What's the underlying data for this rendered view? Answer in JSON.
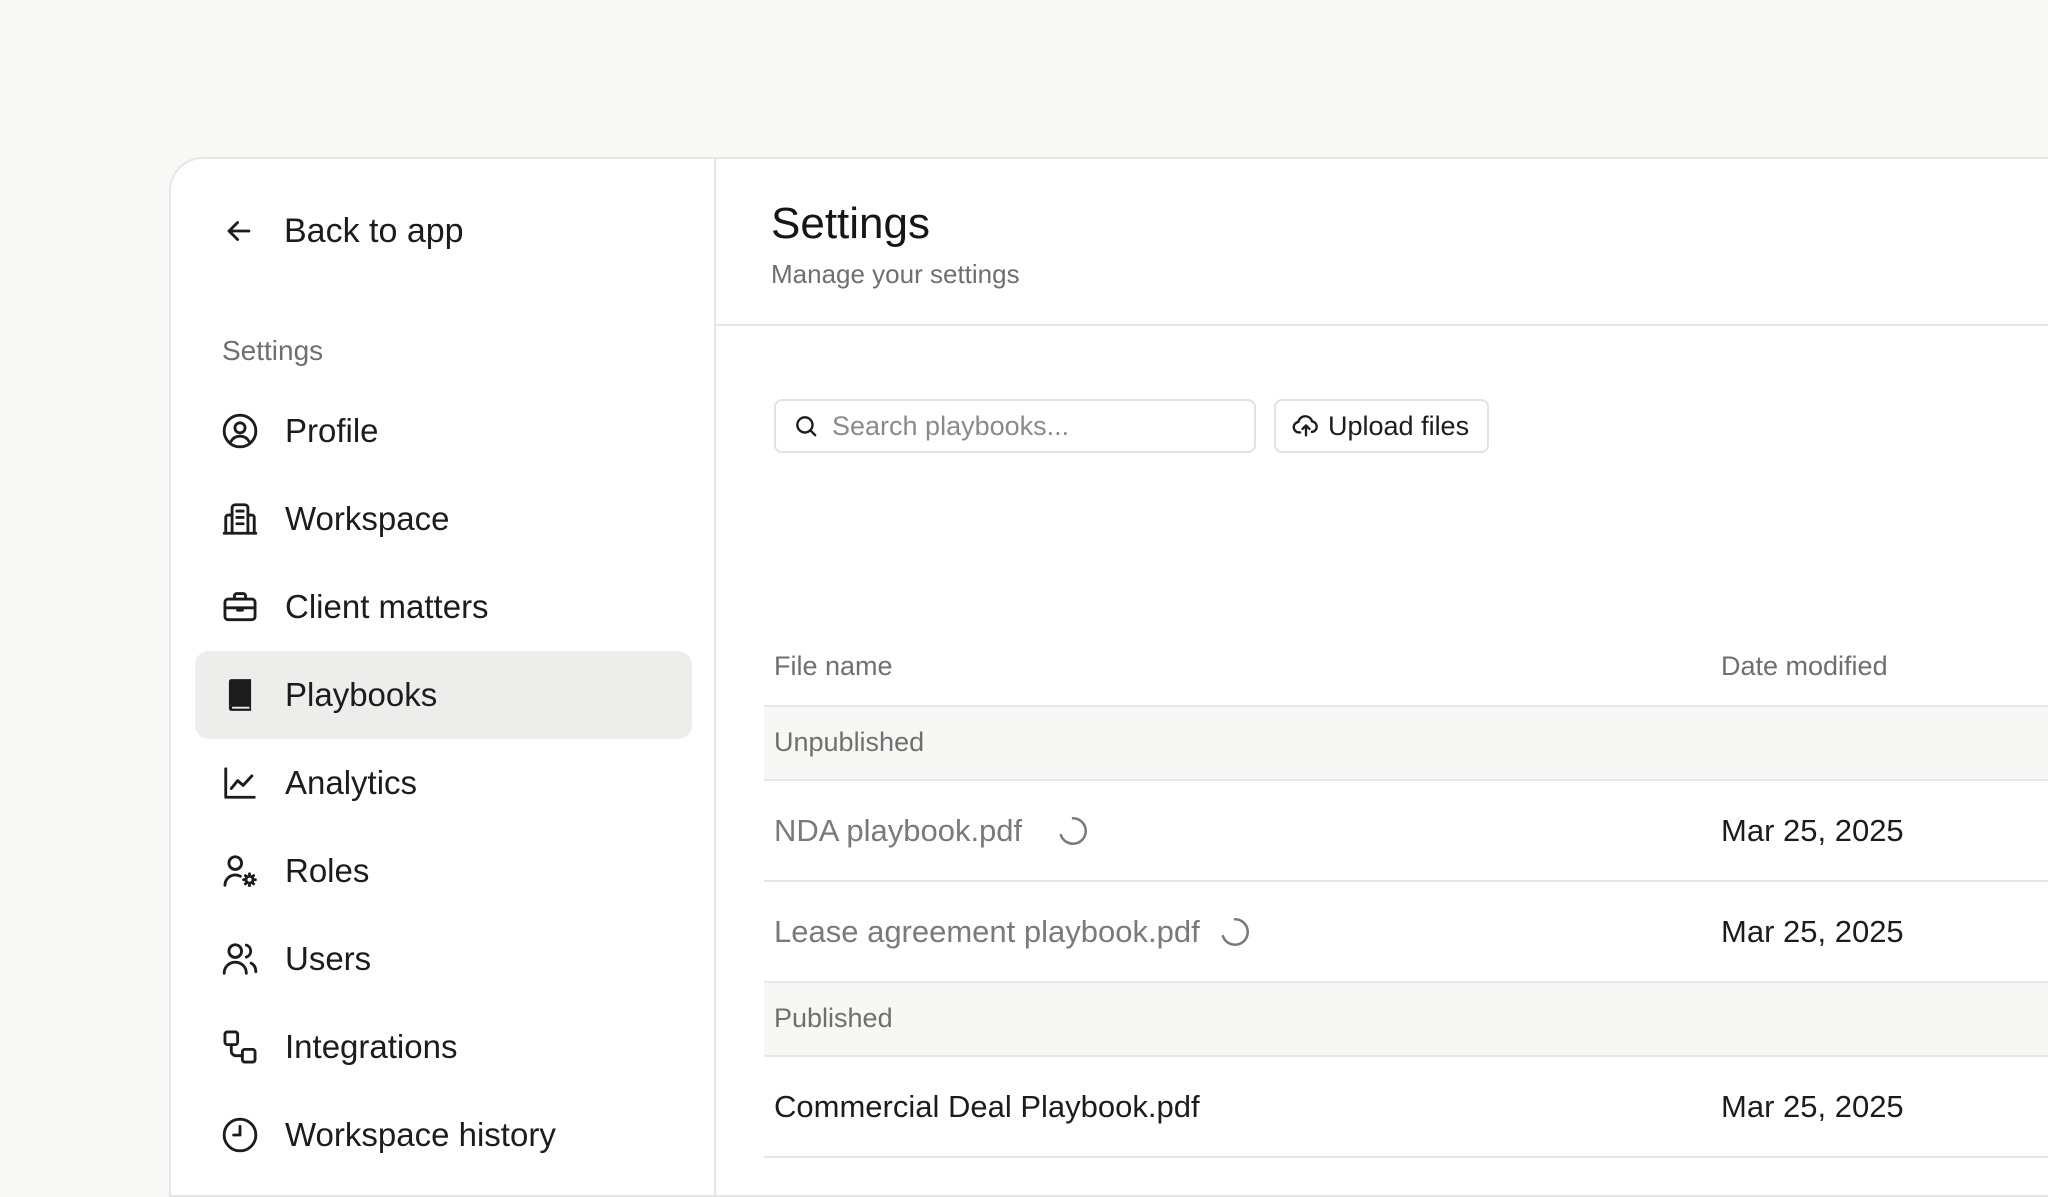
{
  "sidebar": {
    "back_label": "Back to app",
    "section_label": "Settings",
    "items": [
      {
        "label": "Profile",
        "icon": "user-circle-icon",
        "active": false
      },
      {
        "label": "Workspace",
        "icon": "building-icon",
        "active": false
      },
      {
        "label": "Client matters",
        "icon": "briefcase-icon",
        "active": false
      },
      {
        "label": "Playbooks",
        "icon": "book-icon",
        "active": true
      },
      {
        "label": "Analytics",
        "icon": "line-chart-icon",
        "active": false
      },
      {
        "label": "Roles",
        "icon": "user-gear-icon",
        "active": false
      },
      {
        "label": "Users",
        "icon": "users-icon",
        "active": false
      },
      {
        "label": "Integrations",
        "icon": "integrations-icon",
        "active": false
      },
      {
        "label": "Workspace history",
        "icon": "clock-icon",
        "active": false
      }
    ]
  },
  "header": {
    "title": "Settings",
    "subtitle": "Manage your settings"
  },
  "toolbar": {
    "search_placeholder": "Search playbooks...",
    "search_value": "",
    "upload_label": "Upload files"
  },
  "table": {
    "columns": {
      "name": "File name",
      "date": "Date modified"
    },
    "groups": [
      {
        "label": "Unpublished",
        "rows": [
          {
            "name": "NDA playbook.pdf",
            "date": "Mar 25, 2025",
            "status": "processing"
          },
          {
            "name": "Lease agreement playbook.pdf",
            "date": "Mar 25, 2025",
            "status": "processing"
          }
        ]
      },
      {
        "label": "Published",
        "rows": [
          {
            "name": "Commercial Deal Playbook.pdf",
            "date": "Mar 25, 2025",
            "status": "published"
          }
        ]
      }
    ]
  },
  "colors": {
    "background": "#f8f8f7",
    "active_nav": "#ededeb",
    "border": "#e6e6e4",
    "muted_text": "#6f6f6d"
  }
}
